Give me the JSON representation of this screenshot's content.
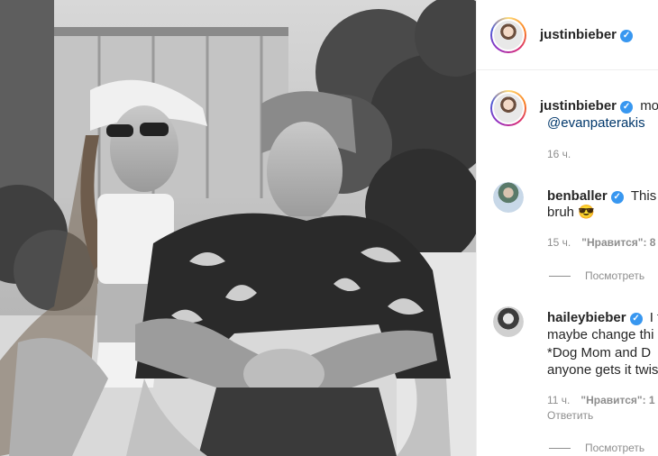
{
  "post": {
    "author": "justinbieber",
    "header_username": "justinbieber",
    "verified_glyph": "✓"
  },
  "caption": {
    "username": "justinbieber",
    "text_start": "mo",
    "mention": "@evanpaterakis",
    "time": "16 ч."
  },
  "comments": [
    {
      "username": "benballer",
      "lines": [
        "This i",
        "bruh 😎"
      ],
      "time": "15 ч.",
      "likes": "\"Нравится\": 8",
      "view_replies": "Посмотреть"
    },
    {
      "username": "haileybieber",
      "lines": [
        "I t",
        "maybe change thi",
        "*Dog Mom and D",
        "anyone gets it twis"
      ],
      "time": "11 ч.",
      "likes": "\"Нравится\": 1",
      "reply": "Ответить",
      "view_replies": "Посмотреть"
    }
  ],
  "colors": {
    "verified": "#3897f0",
    "mention": "#00376b",
    "meta": "#8e8e8e"
  }
}
